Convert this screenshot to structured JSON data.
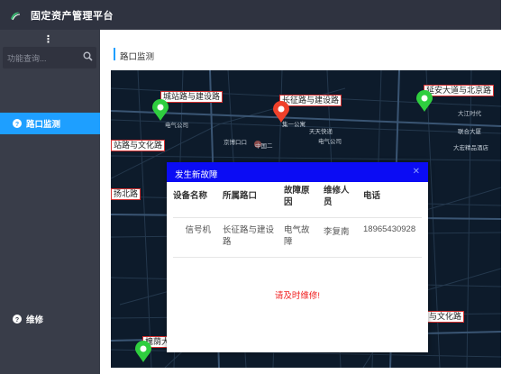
{
  "app": {
    "title": "固定资产管理平台"
  },
  "sidebar": {
    "search_placeholder": "功能查询...",
    "items": [
      {
        "label": "路口监测"
      },
      {
        "label": "维修"
      }
    ]
  },
  "breadcrumb": {
    "label": "路口监测"
  },
  "map": {
    "road_labels": [
      "城站路与建设路",
      "长征路与建设路",
      "延安大道与北京路",
      "站路与文化路",
      "扬北路",
      "与文化路",
      "槐荫大"
    ],
    "pois": [
      "集一公寓",
      "中国二",
      "天天快递",
      "京博口口",
      "电气公司",
      "电气公司",
      "大江时代",
      "联合大厦",
      "大宏精品酒店"
    ]
  },
  "modal": {
    "title": "发生新故障",
    "columns": [
      "设备名称",
      "所属路口",
      "故障原因",
      "维修人员",
      "电话"
    ],
    "rows": [
      [
        "信号机",
        "长征路与建设路",
        "电气故障",
        "李复南",
        "18965430928"
      ]
    ],
    "message": "请及时维修!"
  },
  "colors": {
    "accent": "#1e9fff",
    "modal_header": "#0b0cf4",
    "warning": "#f01f1f"
  }
}
